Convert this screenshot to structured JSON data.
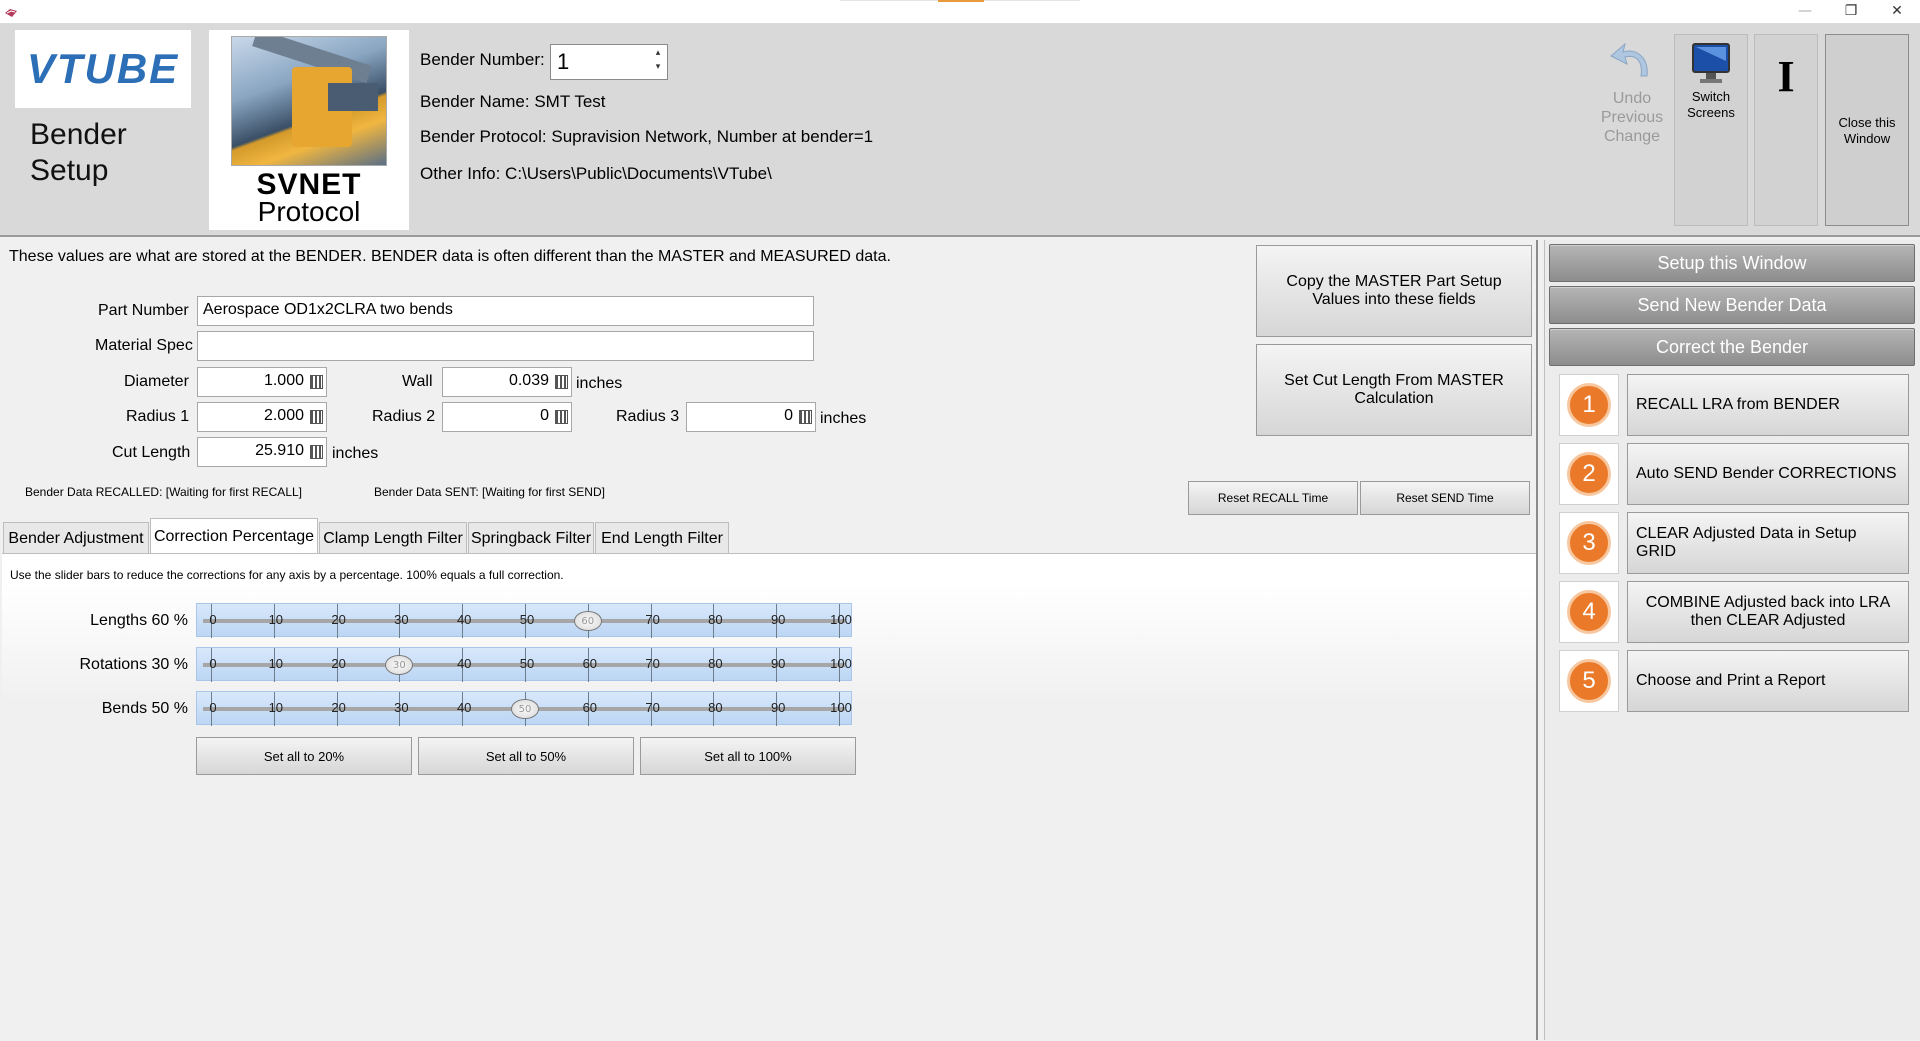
{
  "titlebar": {
    "minimize": "—",
    "restore": "❐",
    "close": "✕"
  },
  "header": {
    "logo": "VTUBE",
    "screen_title": "Bender Setup",
    "protocol_line1": "SVNET",
    "protocol_line2": "Protocol",
    "bender_number_label": "Bender Number:",
    "bender_number_value": "1",
    "bender_name": "Bender Name: SMT Test",
    "bender_protocol": "Bender Protocol: Supravision Network, Number at bender=1",
    "other_info": "Other Info: C:\\Users\\Public\\Documents\\VTube\\",
    "undo_label": "Undo Previous Change",
    "switch_label": "Switch Screens",
    "cursor_glyph": "I",
    "close_label": "Close this Window"
  },
  "main": {
    "info_text": "These values are what are stored at the BENDER.  BENDER data is often different than the MASTER and MEASURED data.",
    "part_number_label": "Part Number",
    "part_number_value": "Aerospace OD1x2CLRA two bends",
    "material_spec_label": "Material Spec",
    "material_spec_value": "",
    "diameter_label": "Diameter",
    "diameter_value": "1.000",
    "wall_label": "Wall",
    "wall_value": "0.039",
    "units_inches": "inches",
    "radius1_label": "Radius 1",
    "radius1_value": "2.000",
    "radius2_label": "Radius 2",
    "radius2_value": "0",
    "radius3_label": "Radius 3",
    "radius3_value": "0",
    "cut_length_label": "Cut Length",
    "cut_length_value": "25.910",
    "copy_master_btn": "Copy the MASTER Part Setup Values into these fields",
    "set_cut_btn": "Set Cut Length From MASTER Calculation",
    "recalled_status": "Bender Data RECALLED:  [Waiting for first RECALL]",
    "sent_status": "Bender Data SENT:  [Waiting for first SEND]",
    "reset_recall_btn": "Reset RECALL Time",
    "reset_send_btn": "Reset SEND Time"
  },
  "tabs": [
    {
      "label": "Bender Adjustment"
    },
    {
      "label": "Correction Percentage"
    },
    {
      "label": "Clamp Length Filter"
    },
    {
      "label": "Springback Filter"
    },
    {
      "label": "End Length Filter"
    }
  ],
  "correction": {
    "instructions": "Use the slider bars to reduce the corrections for any axis by a percentage. 100% equals a full correction.",
    "ticks": [
      "0",
      "10",
      "20",
      "30",
      "40",
      "50",
      "60",
      "70",
      "80",
      "90",
      "100"
    ],
    "sliders": [
      {
        "label": "Lengths 60 %",
        "value": 60,
        "thumb": "60"
      },
      {
        "label": "Rotations 30 %",
        "value": 30,
        "thumb": "30"
      },
      {
        "label": "Bends 50 %",
        "value": 50,
        "thumb": "50"
      }
    ],
    "set20_btn": "Set all to 20%",
    "set50_btn": "Set all to 50%",
    "set100_btn": "Set all to 100%"
  },
  "right_panel": {
    "setup_btn": "Setup this Window",
    "send_btn": "Send New Bender Data",
    "correct_btn": "Correct the Bender",
    "steps": [
      {
        "num": "1",
        "label": "RECALL LRA from BENDER"
      },
      {
        "num": "2",
        "label": "Auto SEND Bender CORRECTIONS"
      },
      {
        "num": "3",
        "label": "CLEAR Adjusted Data in Setup GRID"
      },
      {
        "num": "4",
        "label": "COMBINE Adjusted back into LRA then CLEAR Adjusted"
      },
      {
        "num": "5",
        "label": "Choose and Print a Report"
      }
    ]
  },
  "colors": {
    "accent_orange": "#ea7a2a",
    "logo_blue": "#2d6fb6",
    "slider_blue": "#bcd6f4"
  }
}
